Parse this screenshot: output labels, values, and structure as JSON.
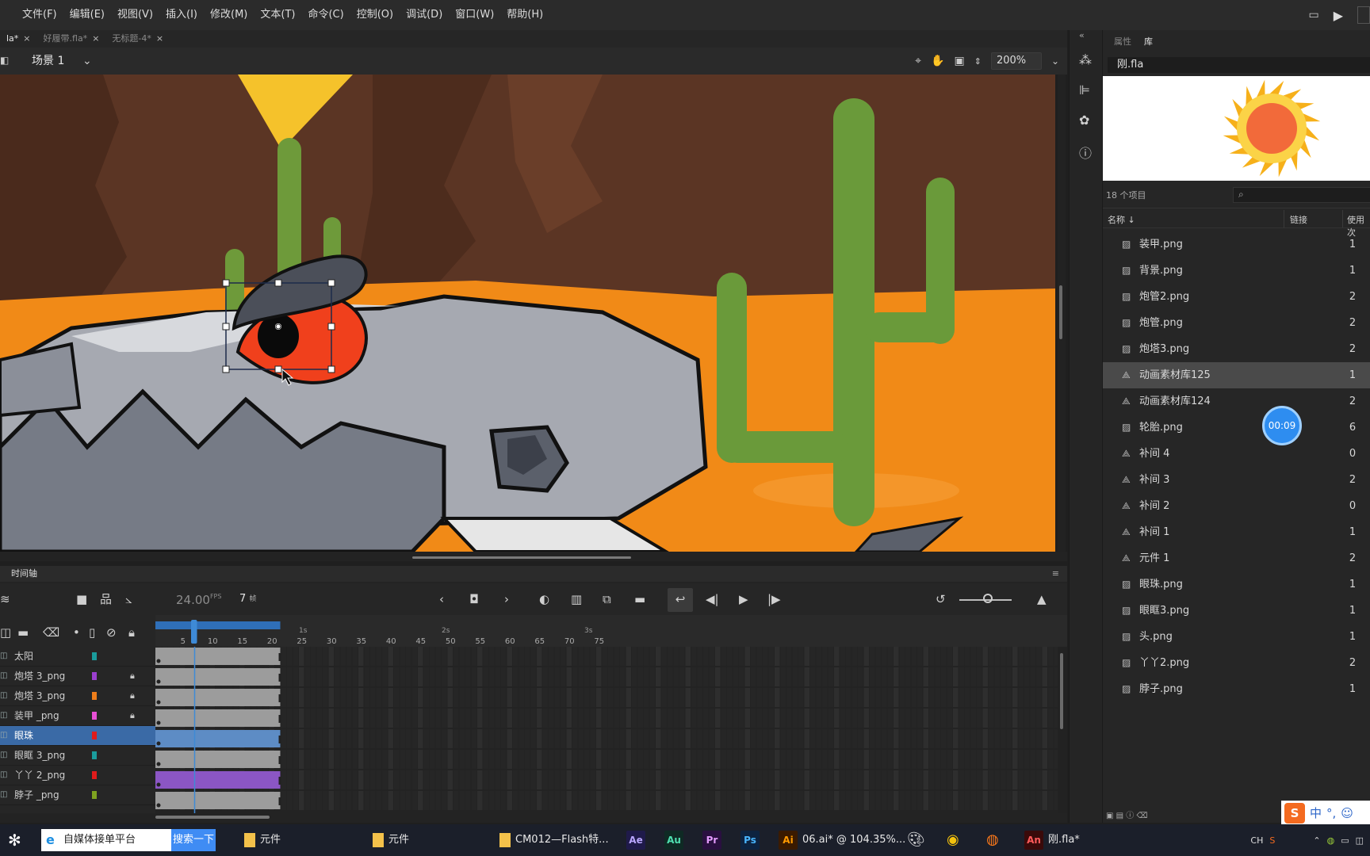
{
  "menubar": {
    "items": [
      "文件(F)",
      "编辑(E)",
      "视图(V)",
      "插入(I)",
      "修改(M)",
      "文本(T)",
      "命令(C)",
      "控制(O)",
      "调试(D)",
      "窗口(W)",
      "帮助(H)"
    ]
  },
  "tabs": [
    {
      "label": "la*",
      "close": "×"
    },
    {
      "label": "好履带.fla*",
      "close": "×"
    },
    {
      "label": "无标题-4*",
      "close": "×"
    }
  ],
  "scene": {
    "label": "场景 1",
    "zoom": "200%"
  },
  "timeline": {
    "title": "时间轴",
    "fps_value": "24.00",
    "fps_unit": "FPS",
    "frame_value": "7",
    "frame_unit": "帧",
    "ruler_ticks": [
      "5",
      "10",
      "15",
      "20",
      "25",
      "30",
      "35",
      "40",
      "45",
      "50",
      "55",
      "60",
      "65",
      "70",
      "75"
    ],
    "seconds": [
      "1s",
      "2s",
      "3s"
    ],
    "playhead_frame": 7,
    "layers": [
      {
        "name": "太阳",
        "color": "#1a9c9c",
        "locked": false,
        "selected": false
      },
      {
        "name": "炮塔 3_png",
        "color": "#9b3fcf",
        "locked": true,
        "selected": false
      },
      {
        "name": "炮塔 3_png",
        "color": "#ee7d1a",
        "locked": true,
        "selected": false
      },
      {
        "name": "装甲 _png",
        "color": "#e84fd5",
        "locked": true,
        "selected": false
      },
      {
        "name": "眼珠",
        "color": "#e01b1b",
        "locked": false,
        "selected": true
      },
      {
        "name": "眼眶 3_png",
        "color": "#1a9c9c",
        "locked": false,
        "selected": false
      },
      {
        "name": "丫丫 2_png",
        "color": "#e01b1b",
        "locked": false,
        "selected": false
      },
      {
        "name": "脖子 _png",
        "color": "#7ea320",
        "locked": false,
        "selected": false
      }
    ]
  },
  "library": {
    "tab_properties": "属性",
    "tab_library": "库",
    "document": "刚.fla",
    "count": "18 个项目",
    "col_name": "名称",
    "col_linkage": "链接",
    "col_usage": "使用次",
    "items": [
      {
        "name": "装甲.png",
        "type": "bitmap",
        "uses": "1"
      },
      {
        "name": "背景.png",
        "type": "bitmap",
        "uses": "1"
      },
      {
        "name": "炮管2.png",
        "type": "bitmap",
        "uses": "2"
      },
      {
        "name": "炮管.png",
        "type": "bitmap",
        "uses": "2"
      },
      {
        "name": "炮塔3.png",
        "type": "bitmap",
        "uses": "2"
      },
      {
        "name": "动画素材库125",
        "type": "symbol",
        "uses": "1",
        "selected": true
      },
      {
        "name": "动画素材库124",
        "type": "symbol",
        "uses": "2"
      },
      {
        "name": "轮胎.png",
        "type": "bitmap",
        "uses": "6"
      },
      {
        "name": "补间 4",
        "type": "symbol",
        "uses": "0"
      },
      {
        "name": "补间 3",
        "type": "symbol",
        "uses": "2"
      },
      {
        "name": "补间 2",
        "type": "symbol",
        "uses": "0"
      },
      {
        "name": "补间 1",
        "type": "symbol",
        "uses": "1"
      },
      {
        "name": "元件 1",
        "type": "symbol",
        "uses": "2"
      },
      {
        "name": "眼珠.png",
        "type": "bitmap",
        "uses": "1"
      },
      {
        "name": "眼眶3.png",
        "type": "bitmap",
        "uses": "1"
      },
      {
        "name": "头.png",
        "type": "bitmap",
        "uses": "1"
      },
      {
        "name": "丫丫2.png",
        "type": "bitmap",
        "uses": "2"
      },
      {
        "name": "脖子.png",
        "type": "bitmap",
        "uses": "1"
      }
    ]
  },
  "overlay": {
    "timer": "00:09",
    "ime": "中"
  },
  "taskbar": {
    "search_text": "自媒体接单平台",
    "search_button": "搜索一下",
    "items": [
      {
        "label": "元件",
        "kind": "folder"
      },
      {
        "label": "元件",
        "kind": "folder"
      },
      {
        "label": "CM012—Flash特...",
        "kind": "folder"
      },
      {
        "label": "06.ai* @ 104.35%...",
        "kind": "ai"
      },
      {
        "label": "刚.fla*",
        "kind": "an"
      }
    ],
    "apps": [
      "Ae",
      "Au",
      "Pr",
      "Ps"
    ],
    "tray_lang": "CH"
  }
}
